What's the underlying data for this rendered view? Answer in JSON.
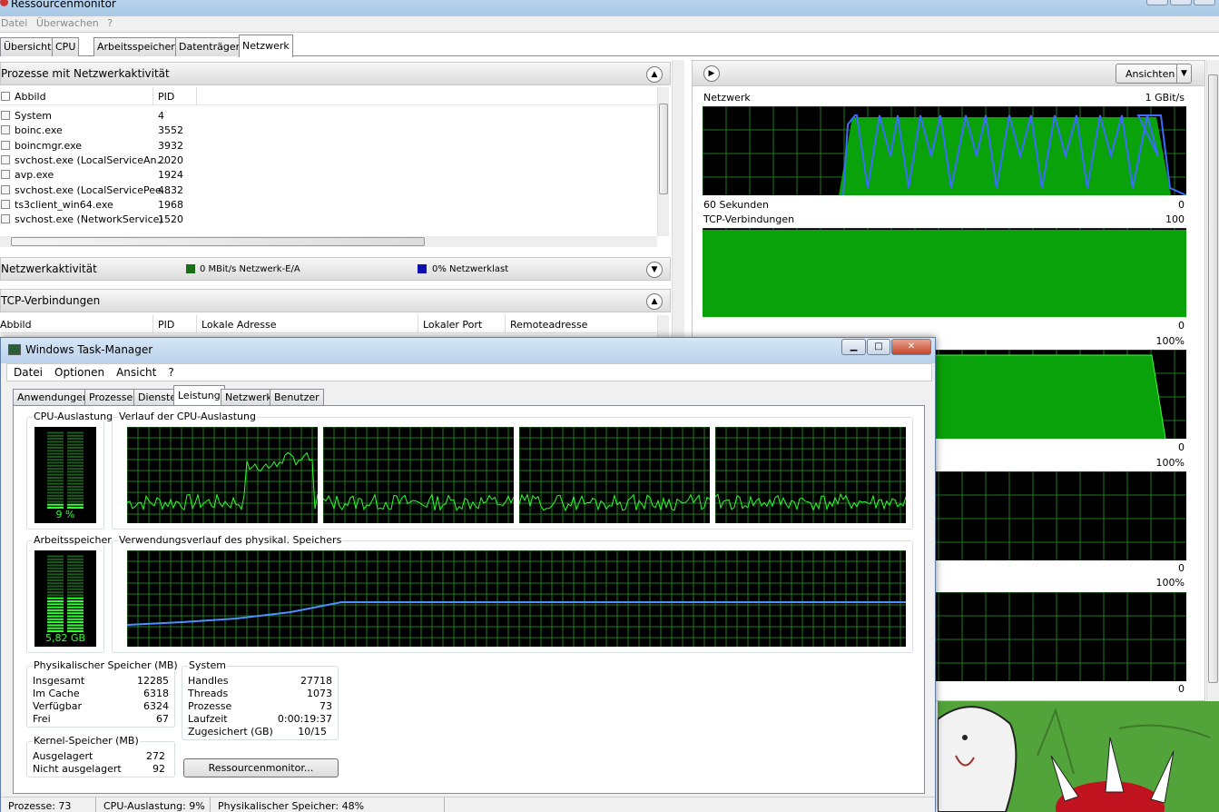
{
  "resmon": {
    "title": "Ressourcenmonitor",
    "menu": [
      "Datei",
      "Überwachen",
      "?"
    ],
    "tabs": [
      "Übersicht",
      "CPU",
      "Arbeitsspeicher",
      "Datenträger",
      "Netzwerk"
    ],
    "active_tab": "Netzwerk",
    "sections": {
      "processes": {
        "title": "Prozesse mit Netzwerkaktivität",
        "col_image": "Abbild",
        "col_pid": "PID",
        "rows": [
          {
            "name": "System",
            "pid": "4"
          },
          {
            "name": "boinc.exe",
            "pid": "3552"
          },
          {
            "name": "boincmgr.exe",
            "pid": "3932"
          },
          {
            "name": "svchost.exe (LocalServiceAn...",
            "pid": "2020"
          },
          {
            "name": "avp.exe",
            "pid": "1924"
          },
          {
            "name": "svchost.exe (LocalServicePee...",
            "pid": "4832"
          },
          {
            "name": "ts3client_win64.exe",
            "pid": "1968"
          },
          {
            "name": "svchost.exe (NetworkService)",
            "pid": "1520"
          }
        ]
      },
      "activity": {
        "title": "Netzwerkaktivität",
        "legend_io": "0 MBit/s Netzwerk-E/A",
        "legend_io_color": "#1a6e1a",
        "legend_load": "0% Netzwerklast",
        "legend_load_color": "#1010b0"
      },
      "tcp": {
        "title": "TCP-Verbindungen",
        "cols": [
          "Abbild",
          "PID",
          "Lokale Adresse",
          "Lokaler Port",
          "Remoteadresse"
        ]
      }
    },
    "right": {
      "views_button": "Ansichten",
      "graphs": [
        {
          "title": "Netzwerk",
          "max": "1 GBit/s",
          "bottom_left": "60 Sekunden",
          "bottom_right": "0"
        },
        {
          "title": "TCP-Verbindungen",
          "max": "100",
          "bottom_right": "0"
        },
        {
          "title": "",
          "max": "100%",
          "bottom_right": "0"
        },
        {
          "title": "",
          "max": "100%",
          "bottom_right": "0"
        },
        {
          "title": "",
          "max": "100%",
          "bottom_right": "0"
        }
      ]
    }
  },
  "taskmgr": {
    "title": "Windows Task-Manager",
    "menu": [
      "Datei",
      "Optionen",
      "Ansicht",
      "?"
    ],
    "tabs": [
      "Anwendungen",
      "Prozesse",
      "Dienste",
      "Leistung",
      "Netzwerk",
      "Benutzer"
    ],
    "active_tab": "Leistung",
    "cpu_usage_label": "CPU-Auslastung",
    "cpu_usage_value": "9 %",
    "cpu_usage_percent": 9,
    "cpu_history_label": "Verlauf der CPU-Auslastung",
    "mem_label": "Arbeitsspeicher",
    "mem_value": "5,82 GB",
    "mem_percent": 48,
    "mem_history_label": "Verwendungsverlauf des physikal. Speichers",
    "physical": {
      "title": "Physikalischer Speicher (MB)",
      "rows": [
        {
          "label": "Insgesamt",
          "value": "12285"
        },
        {
          "label": "Im Cache",
          "value": "6318"
        },
        {
          "label": "Verfügbar",
          "value": "6324"
        },
        {
          "label": "Frei",
          "value": "67"
        }
      ]
    },
    "kernel": {
      "title": "Kernel-Speicher (MB)",
      "rows": [
        {
          "label": "Ausgelagert",
          "value": "272"
        },
        {
          "label": "Nicht ausgelagert",
          "value": "92"
        }
      ]
    },
    "system": {
      "title": "System",
      "rows": [
        {
          "label": "Handles",
          "value": "27718"
        },
        {
          "label": "Threads",
          "value": "1073"
        },
        {
          "label": "Prozesse",
          "value": "73"
        },
        {
          "label": "Laufzeit",
          "value": "0:00:19:37"
        },
        {
          "label": "Zugesichert (GB)",
          "value": "10/15"
        }
      ]
    },
    "resmon_button": "Ressourcenmonitor...",
    "status": {
      "processes": "Prozesse: 73",
      "cpu": "CPU-Auslastung: 9%",
      "memory": "Physikalischer Speicher: 48%"
    }
  }
}
